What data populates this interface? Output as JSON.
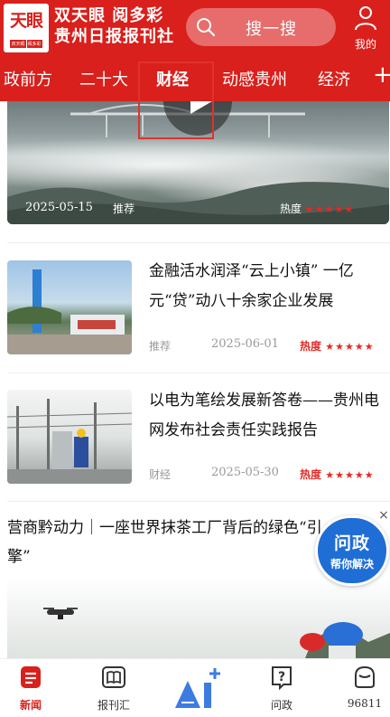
{
  "header": {
    "logo_text": "天眼",
    "logo_badges": [
      "双天眼",
      "阅多彩"
    ],
    "brand_top": "双天眼 阅多彩",
    "brand_bottom": "贵州日报报刊社",
    "search_text": "搜一搜",
    "search_icon": "search-icon",
    "me_label": "我的",
    "me_icon": "user-icon"
  },
  "tabs": [
    {
      "label": "政前方",
      "active": false
    },
    {
      "label": "二十大",
      "active": false
    },
    {
      "label": "财经",
      "active": true
    },
    {
      "label": "动感贵州",
      "active": false
    },
    {
      "label": "经济",
      "active": false
    }
  ],
  "tabs_more": "+",
  "video_card": {
    "date": "2025-05-15",
    "tag": "推荐",
    "heat_label": "热度",
    "heat_stars": 5
  },
  "news": [
    {
      "title": "金融活水润泽“云上小镇” 一亿元“贷”动八十余家企业发展",
      "tag": "推荐",
      "date": "2025-06-01",
      "heat_label": "热度",
      "heat_stars": 5
    },
    {
      "title": "以电为笔绘发展新答卷——贵州电网发布社会责任实践报告",
      "tag": "财经",
      "date": "2025-05-30",
      "heat_label": "热度",
      "heat_stars": 5
    }
  ],
  "headline": "营商黔动力｜一座世界抹茶工厂背后的绿色“引擎”",
  "float_ask": {
    "title": "问政",
    "subtitle": "帮你解决",
    "close": "×"
  },
  "bottom_nav": [
    {
      "label": "新闻",
      "icon": "news-icon",
      "active": true
    },
    {
      "label": "报刊汇",
      "icon": "book-icon",
      "active": false
    },
    {
      "label": "",
      "icon": "ai-icon",
      "active": false
    },
    {
      "label": "问政",
      "icon": "question-icon",
      "active": false
    },
    {
      "label": "96811",
      "icon": "service-icon",
      "active": false
    }
  ],
  "colors": {
    "brand_red": "#d9201c",
    "ask_blue": "#1f6ed6",
    "heat_red": "#e12b27"
  }
}
